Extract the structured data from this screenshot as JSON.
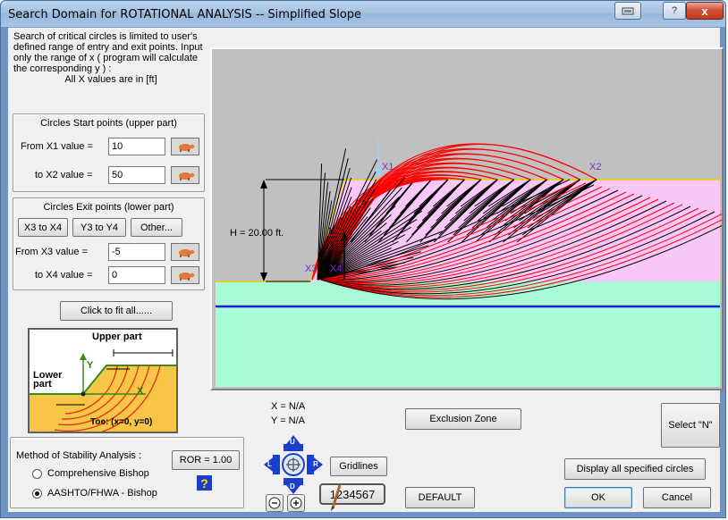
{
  "window": {
    "title": "Search Domain for  ROTATIONAL ANALYSIS -- Simplified Slope",
    "close_glyph": "x",
    "help_glyph": "?"
  },
  "intro": {
    "text": "Search of critical circles is limited to user's defined range of entry and exit points.  Input only the range of x  ( program will calculate the corresponding  y ) :",
    "units": "All  X  values are in [ft]"
  },
  "start_points": {
    "title": "Circles Start points (upper part)",
    "x1_label": "From X1 value =",
    "x1_value": "10",
    "x2_label": "to  X2 value =",
    "x2_value": "50"
  },
  "exit_points": {
    "title": "Circles Exit points (lower part)",
    "tabs": [
      "X3 to X4",
      "Y3 to Y4",
      "Other..."
    ],
    "x3_label": "From X3 value =",
    "x3_value": "-5",
    "x4_label": "to  X4 value =",
    "x4_value": "0"
  },
  "fit_button": "Click to fit all......",
  "sketch": {
    "upper": "Upper part",
    "lower": "Lower part",
    "y": "Y",
    "x": "X",
    "toe": "Toe: (x=0, y=0)"
  },
  "plot": {
    "h_label": "H = 20.00 ft.",
    "x1": "X1",
    "x2": "X2",
    "x3": "X3",
    "x4": "X4",
    "y": "Y"
  },
  "coords": {
    "x_readout": "X = N/A",
    "y_readout": "Y = N/A"
  },
  "buttons": {
    "exclusion_zone": "Exclusion Zone",
    "select_n": "Select \"N\"",
    "gridlines": "Gridlines",
    "number_format": "1234567",
    "default": "DEFAULT",
    "display_all": "Display all specified circles",
    "ok": "OK",
    "cancel": "Cancel",
    "ror": "ROR = 1.00",
    "help": "?"
  },
  "nav_pad": {
    "up": "U",
    "down": "D",
    "left": "L",
    "right": "R"
  },
  "method": {
    "title": "Method of Stability Analysis :",
    "options": [
      "Comprehensive Bishop",
      "AASHTO/FHWA - Bishop"
    ],
    "selected_index": 1
  },
  "colors": {
    "plot_bg": "#c0c0c0",
    "upper_soil": "#f9c8f9",
    "lower_soil": "#a9fbd7",
    "water_line": "#1a1ad6",
    "circles": "#ff0000"
  }
}
